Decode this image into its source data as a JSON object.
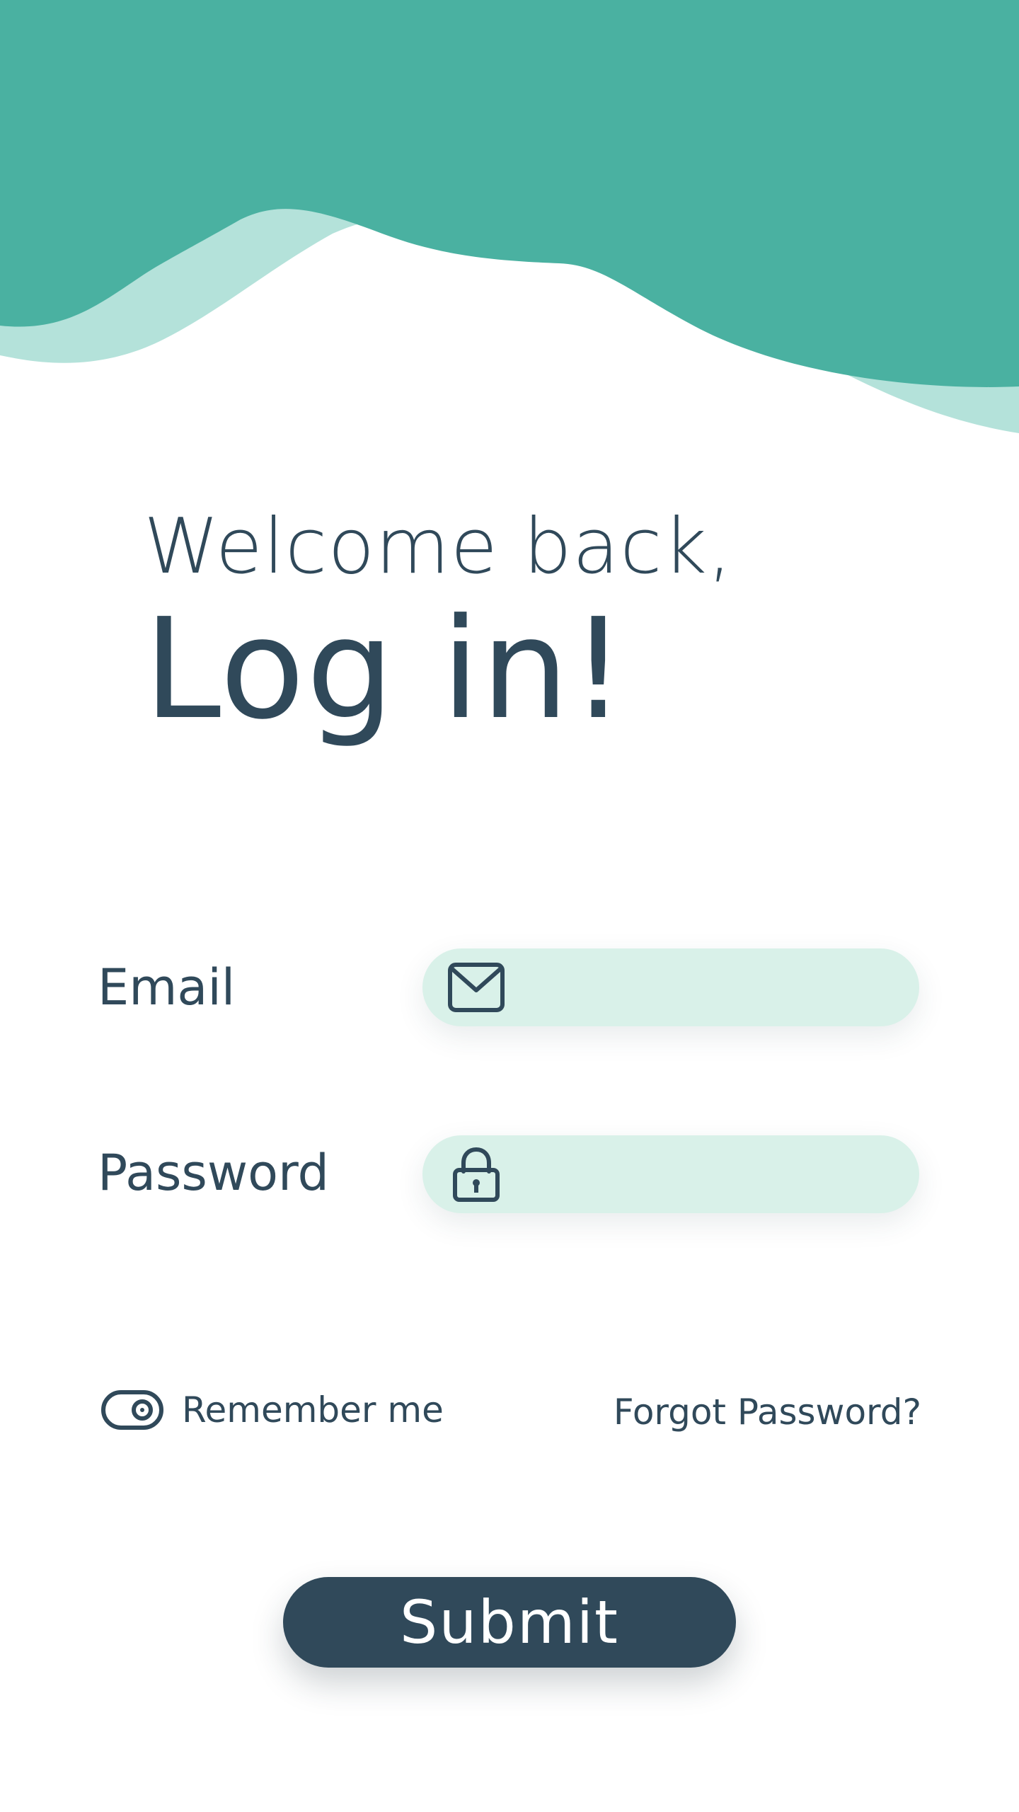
{
  "header": {
    "greeting": "Welcome back,",
    "title": "Log in!"
  },
  "form": {
    "email": {
      "label": "Email",
      "value": "",
      "placeholder": "",
      "icon": "mail-icon"
    },
    "password": {
      "label": "Password",
      "value": "",
      "placeholder": "",
      "icon": "lock-icon"
    },
    "remember": {
      "label": "Remember me",
      "icon": "toggle-icon"
    },
    "forgot_label": "Forgot Password?",
    "submit_label": "Submit"
  },
  "colors": {
    "primary_teal": "#4ab1a1",
    "light_teal": "#b4e2da",
    "field_bg": "#d9f1e9",
    "text_dark": "#30495a",
    "button_bg": "#30495a"
  }
}
